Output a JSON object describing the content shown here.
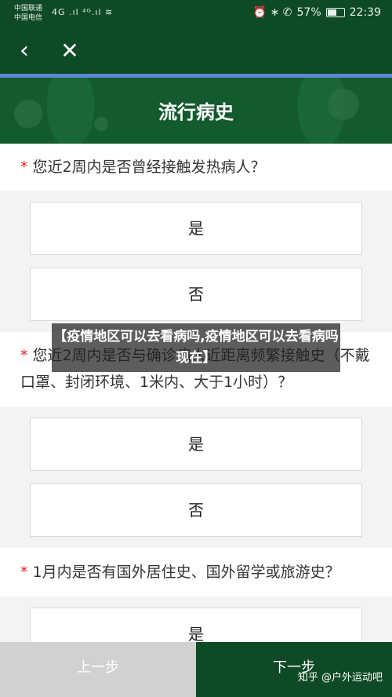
{
  "status_bar": {
    "carrier_1": "中国联通",
    "carrier_2": "中国电信",
    "signal_text": "4G .ıl ⁴ᴳ.ıl ≋",
    "icons_text": "⏰ ∗ ✆",
    "battery_pct": "57%",
    "battery_level": 0.57,
    "time": "22:39"
  },
  "navbar": {
    "back_icon": "‹",
    "close_icon": "✕"
  },
  "banner": {
    "title": "流行病史"
  },
  "questions": [
    {
      "required": "*",
      "text": "您近2周内是否曾经接触发热病人？",
      "options": [
        "是",
        "否"
      ]
    },
    {
      "required": "*",
      "text": "您近2周内是否与确诊病人近距离频繁接触史（不戴口罩、封闭环境、1米内、大于1小时）？",
      "options": [
        "是",
        "否"
      ]
    },
    {
      "required": "*",
      "text": "1月内是否有国外居住史、国外留学或旅游史？",
      "options": [
        "是"
      ]
    }
  ],
  "overlay": {
    "text": "【疫情地区可以去看病吗,疫情地区可以去看病吗现在】"
  },
  "footer": {
    "prev_label": "上一步",
    "next_label": "下一步"
  },
  "watermark": {
    "text": "知乎 @户外运动吧"
  },
  "colors": {
    "primary": "#0f4a26",
    "accent_line": "#5d86d4",
    "required": "#e02020"
  }
}
